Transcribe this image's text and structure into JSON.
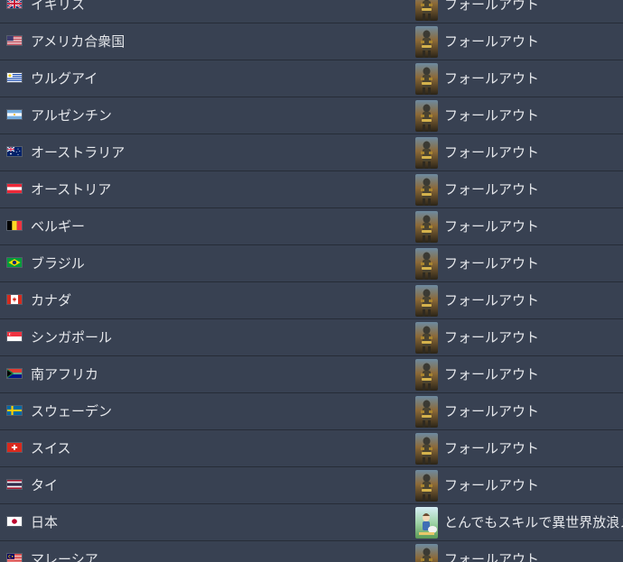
{
  "rows": [
    {
      "country": "イギリス",
      "flag": "uk-flag-icon",
      "game": "フォールアウト",
      "cover": "fallout-cover"
    },
    {
      "country": "アメリカ合衆国",
      "flag": "us-flag-icon",
      "game": "フォールアウト",
      "cover": "fallout-cover"
    },
    {
      "country": "ウルグアイ",
      "flag": "uruguay-flag-icon",
      "game": "フォールアウト",
      "cover": "fallout-cover"
    },
    {
      "country": "アルゼンチン",
      "flag": "argentina-flag-icon",
      "game": "フォールアウト",
      "cover": "fallout-cover"
    },
    {
      "country": "オーストラリア",
      "flag": "australia-flag-icon",
      "game": "フォールアウト",
      "cover": "fallout-cover"
    },
    {
      "country": "オーストリア",
      "flag": "austria-flag-icon",
      "game": "フォールアウト",
      "cover": "fallout-cover"
    },
    {
      "country": "ベルギー",
      "flag": "belgium-flag-icon",
      "game": "フォールアウト",
      "cover": "fallout-cover"
    },
    {
      "country": "ブラジル",
      "flag": "brazil-flag-icon",
      "game": "フォールアウト",
      "cover": "fallout-cover"
    },
    {
      "country": "カナダ",
      "flag": "canada-flag-icon",
      "game": "フォールアウト",
      "cover": "fallout-cover"
    },
    {
      "country": "シンガポール",
      "flag": "singapore-flag-icon",
      "game": "フォールアウト",
      "cover": "fallout-cover"
    },
    {
      "country": "南アフリカ",
      "flag": "south-africa-flag-icon",
      "game": "フォールアウト",
      "cover": "fallout-cover"
    },
    {
      "country": "スウェーデン",
      "flag": "sweden-flag-icon",
      "game": "フォールアウト",
      "cover": "fallout-cover"
    },
    {
      "country": "スイス",
      "flag": "switzerland-flag-icon",
      "game": "フォールアウト",
      "cover": "fallout-cover"
    },
    {
      "country": "タイ",
      "flag": "thailand-flag-icon",
      "game": "フォールアウト",
      "cover": "fallout-cover"
    },
    {
      "country": "日本",
      "flag": "japan-flag-icon",
      "game": "とんでもスキルで異世界放浪メシ",
      "cover": "tondemo-cover"
    },
    {
      "country": "マレーシア",
      "flag": "malaysia-flag-icon",
      "game": "フォールアウト",
      "cover": "fallout-cover"
    }
  ],
  "colors": {
    "background": "#323a48",
    "row": "#384152",
    "divider": "#262c37",
    "text": "#e5e7eb"
  }
}
